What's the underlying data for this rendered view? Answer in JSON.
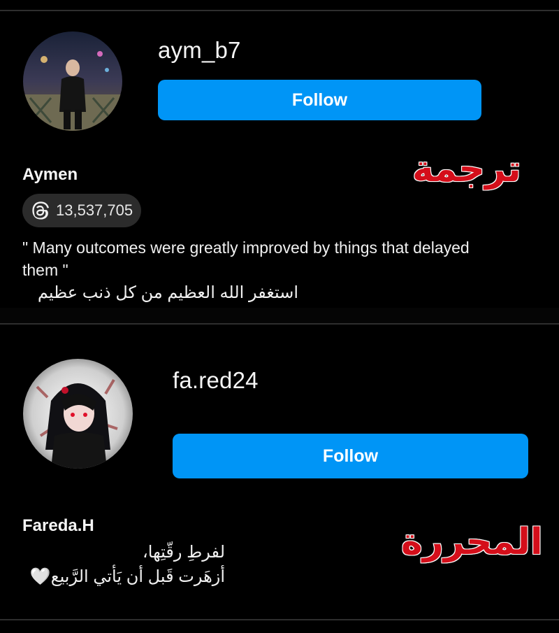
{
  "profiles": [
    {
      "username": "aym_b7",
      "follow_label": "Follow",
      "display_name": "Aymen",
      "threads_count": "13,537,705",
      "bio_line1": "\" Many outcomes were greatly improved by things that delayed",
      "bio_line2": "them \"",
      "bio_arabic": "استغفر الله العظيم من كل ذنب عظيم",
      "overlay_label": "ترجمة",
      "overlay_color": "#d40e1a"
    },
    {
      "username": "fa.red24",
      "follow_label": "Follow",
      "display_name": "Fareda.H",
      "bio_arabic_line1": "لفرطِ رقّتِها،",
      "bio_arabic_line2": "أزهَرت قَبل أن يَأتي الرَّبيع🤍",
      "overlay_label": "المحررة",
      "overlay_color": "#d40e1a"
    }
  ],
  "accent_color": "#0095f6",
  "icons": [
    "threads-icon",
    "avatar-photo-icon"
  ]
}
